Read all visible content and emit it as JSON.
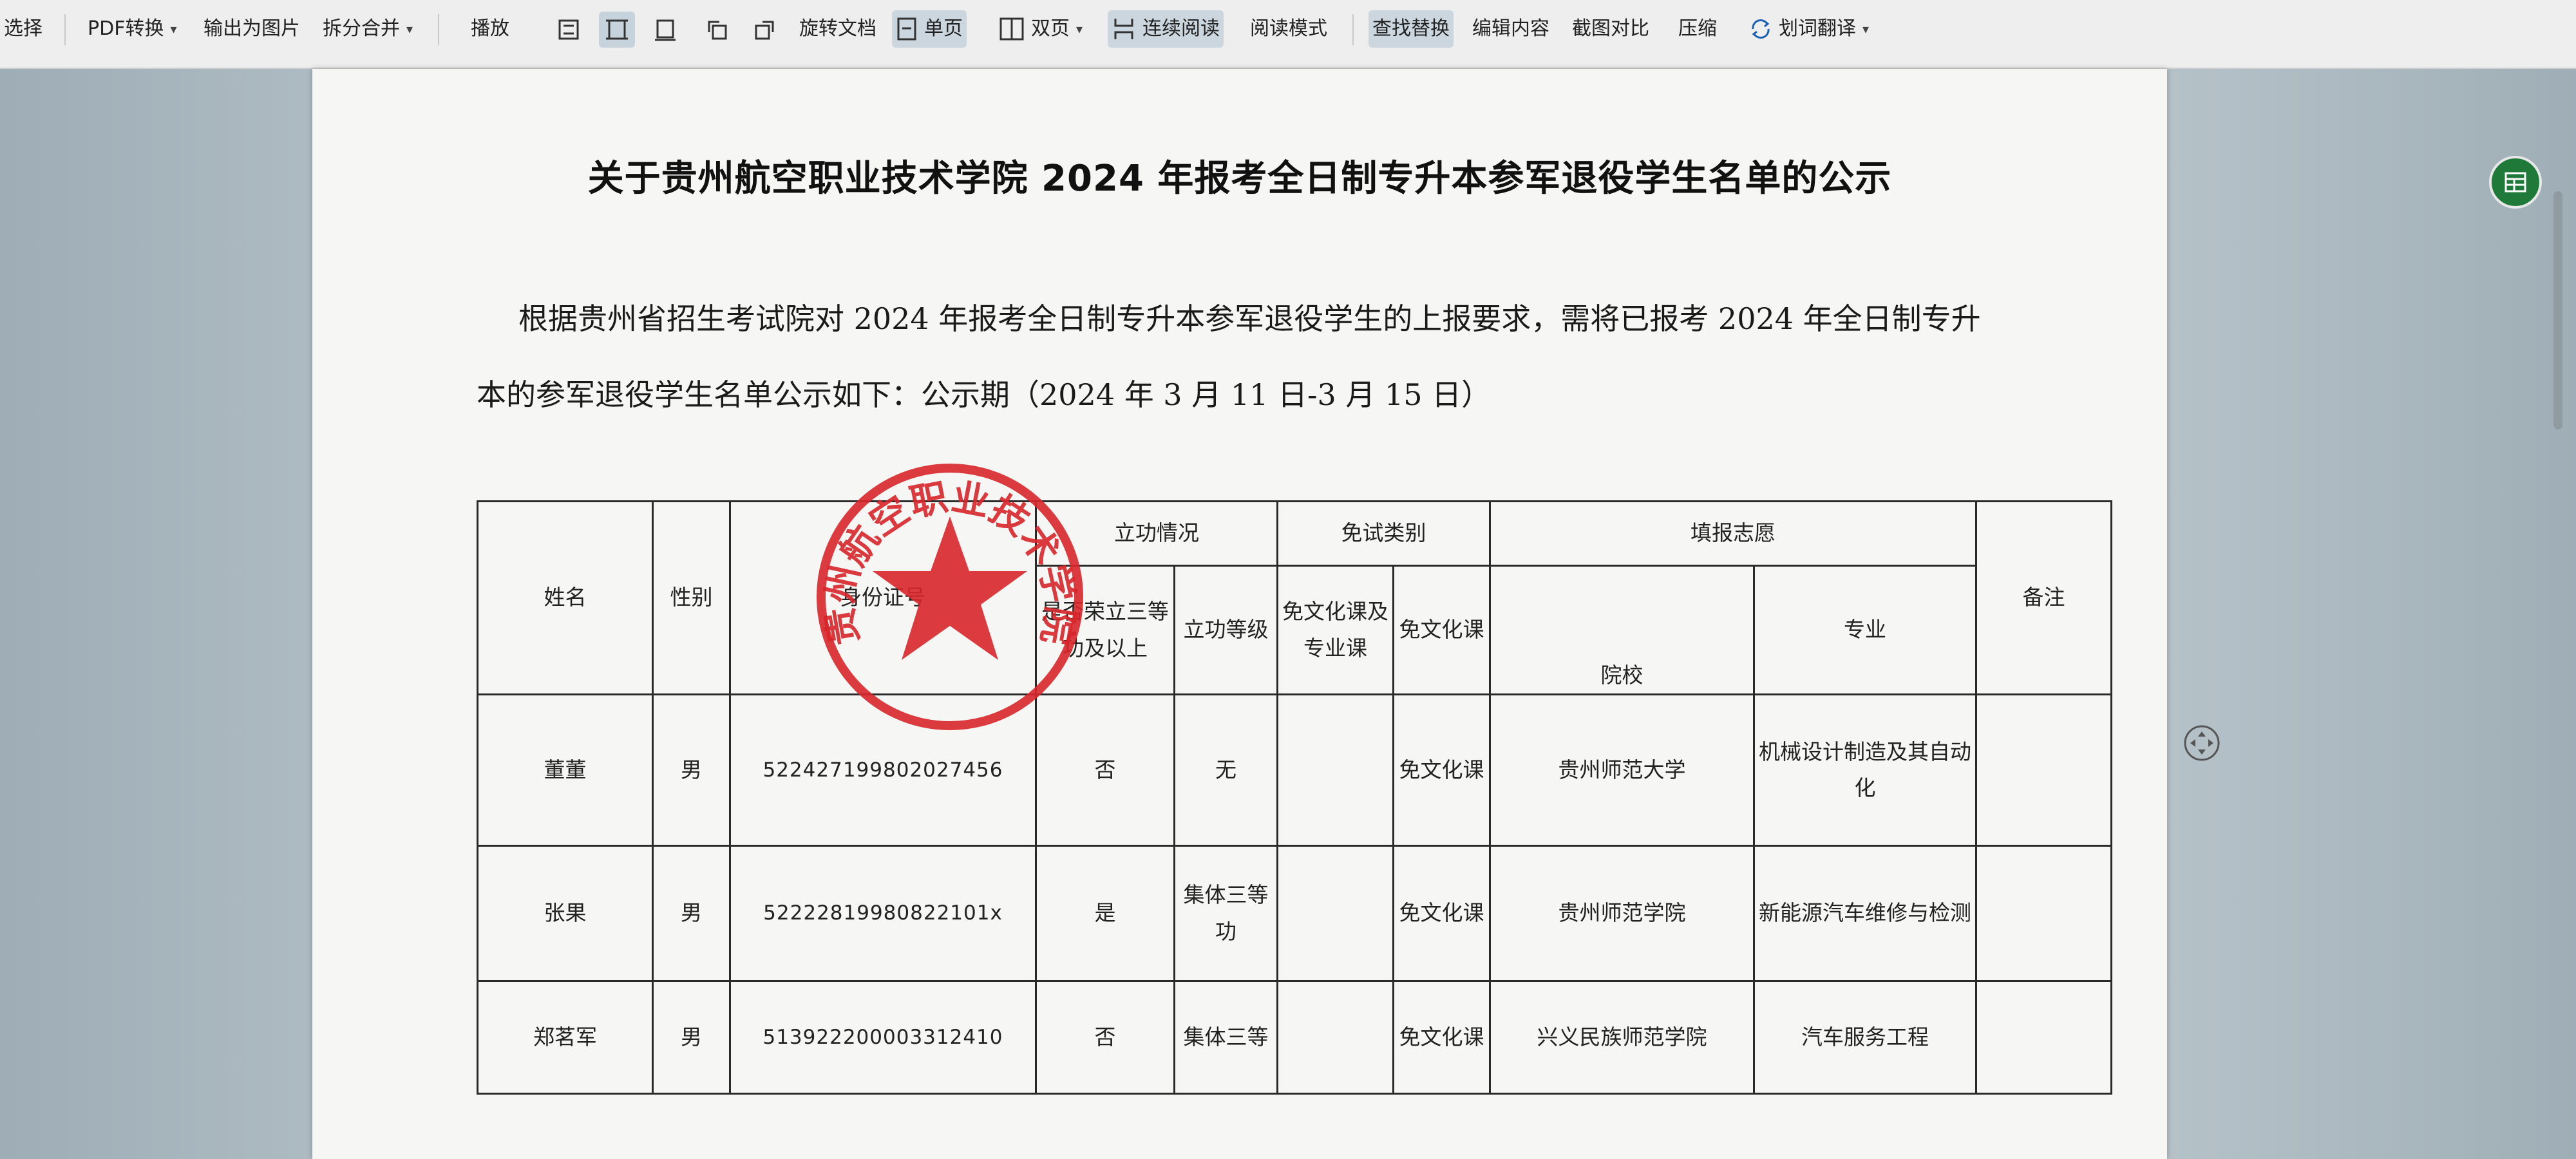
{
  "toolbar": {
    "select_label": "选择",
    "pdf_convert_label": "PDF转换",
    "export_image_label": "输出为图片",
    "split_merge_label": "拆分合并",
    "play_label": "播放",
    "rotate_doc_label": "旋转文档",
    "single_page_label": "单页",
    "double_page_label": "双页",
    "continuous_read_label": "连续阅读",
    "read_mode_label": "阅读模式",
    "find_replace_label": "查找替换",
    "edit_content_label": "编辑内容",
    "screenshot_compare_label": "截图对比",
    "compress_label": "压缩",
    "translate_label": "划词翻译"
  },
  "document": {
    "title": "关于贵州航空职业技术学院 2024 年报考全日制专升本参军退役学生名单的公示",
    "para_line1": "根据贵州省招生考试院对 2024 年报考全日制专升本参军退役学生的上报要求，需将已报考 2024 年全日制专升",
    "para_line2": "本的参军退役学生名单公示如下：公示期（2024 年 3 月 11 日-3 月 15 日）",
    "seal_text": "贵州航空职业技术学院",
    "table": {
      "headers": {
        "name": "姓名",
        "gender": "性别",
        "id_number": "身份证号",
        "merit_group": "立功情况",
        "merit_third_class": "是否荣立三等功及以上",
        "merit_level": "立功等级",
        "exemption_group": "免试类别",
        "exempt_both": "免文化课及专业课",
        "exempt_culture": "免文化课",
        "choice_group": "填报志愿",
        "school": "院校",
        "major": "专业",
        "remarks": "备注"
      },
      "rows": [
        {
          "name": "董董",
          "gender": "男",
          "id_number": "522427199802027456",
          "merit_third_class": "否",
          "merit_level": "无",
          "exempt_both": "",
          "exempt_culture": "免文化课",
          "school": "贵州师范大学",
          "major": "机械设计制造及其自动化",
          "remarks": ""
        },
        {
          "name": "张果",
          "gender": "男",
          "id_number": "52222819980822101x",
          "merit_third_class": "是",
          "merit_level": "集体三等功",
          "exempt_both": "",
          "exempt_culture": "免文化课",
          "school": "贵州师范学院",
          "major": "新能源汽车维修与检测",
          "remarks": ""
        },
        {
          "name": "郑茗军",
          "gender": "男",
          "id_number": "513922200003312410",
          "merit_third_class": "否",
          "merit_level": "集体三等",
          "exempt_both": "",
          "exempt_culture": "免文化课",
          "school": "兴义民族师范学院",
          "major": "汽车服务工程",
          "remarks": ""
        }
      ]
    }
  },
  "colors": {
    "seal_red": "#d8262b",
    "toolbar_active": "#cbd6de",
    "page_bg": "#f6f6f4"
  }
}
